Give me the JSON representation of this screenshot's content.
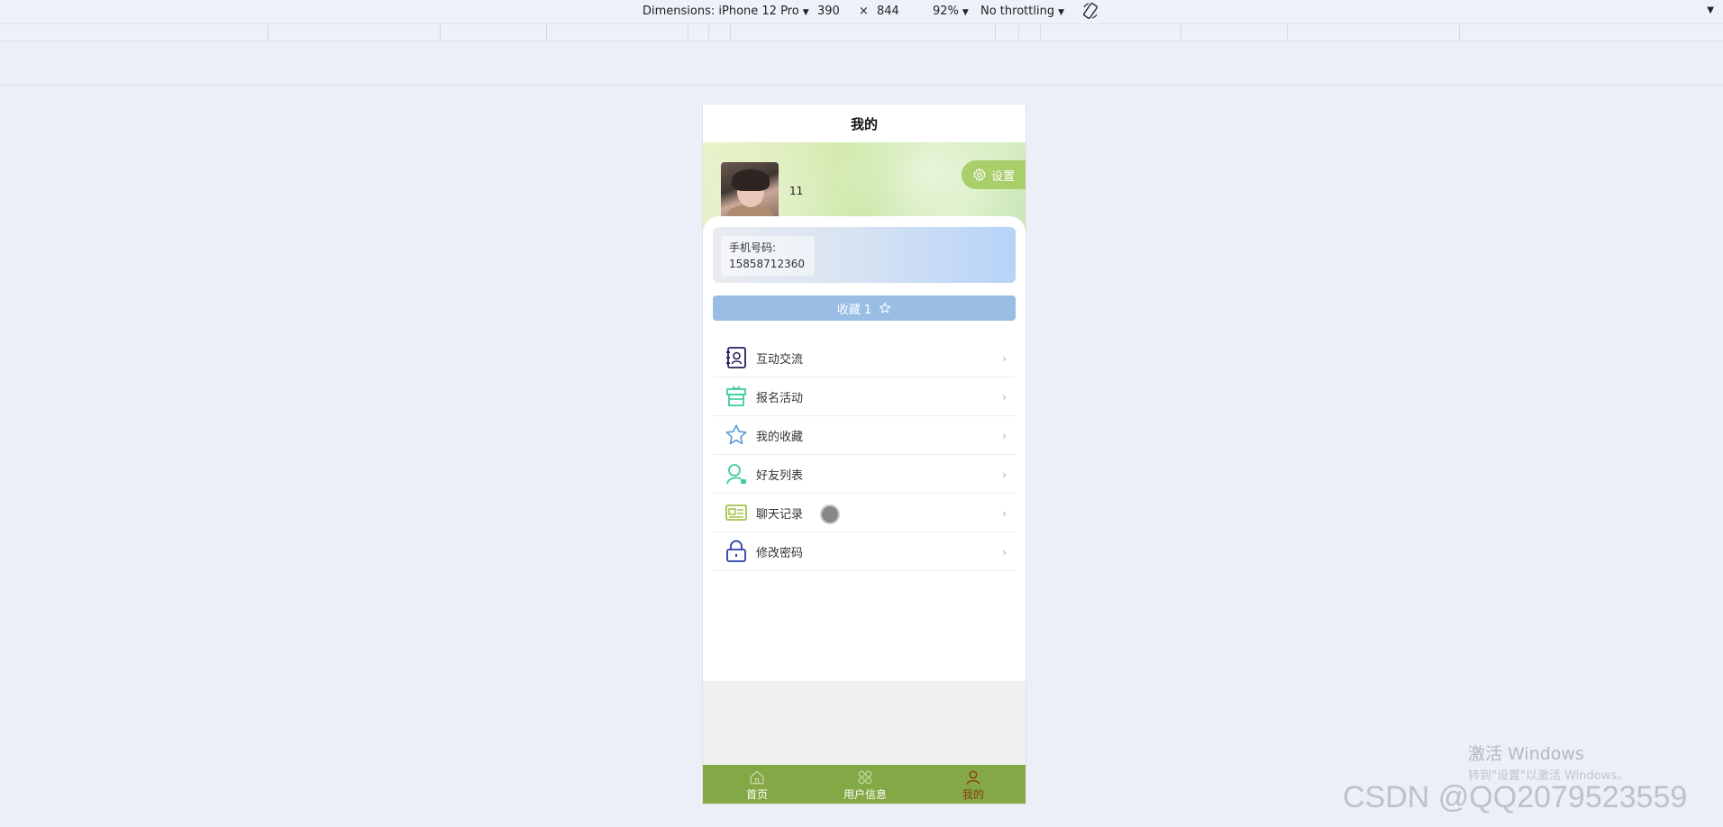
{
  "devtools": {
    "dimensions_label": "Dimensions: iPhone 12 Pro",
    "width": "390",
    "times": "×",
    "height": "844",
    "zoom": "92%",
    "throttling": "No throttling"
  },
  "page": {
    "title": "我的"
  },
  "profile": {
    "username": "11",
    "settings_label": "设置",
    "phone_label": "手机号码:",
    "phone_number": "15858712360"
  },
  "favorites": {
    "label": "收藏 1"
  },
  "menu": {
    "items": [
      {
        "label": "互动交流",
        "icon": "contact-book-icon"
      },
      {
        "label": "报名活动",
        "icon": "gift-icon"
      },
      {
        "label": "我的收藏",
        "icon": "star-icon"
      },
      {
        "label": "好友列表",
        "icon": "user-icon"
      },
      {
        "label": "聊天记录",
        "icon": "id-card-icon"
      },
      {
        "label": "修改密码",
        "icon": "lock-icon"
      }
    ]
  },
  "tabbar": {
    "tabs": [
      {
        "label": "首页",
        "icon": "home-icon"
      },
      {
        "label": "用户信息",
        "icon": "grid-icon"
      },
      {
        "label": "我的",
        "icon": "person-icon"
      }
    ],
    "active_color": "#8a3a10",
    "background": "#84a845"
  },
  "watermark": {
    "line1": "激活 Windows",
    "line2": "转到\"设置\"以激活 Windows。",
    "csdn": "CSDN @QQ2079523559"
  }
}
